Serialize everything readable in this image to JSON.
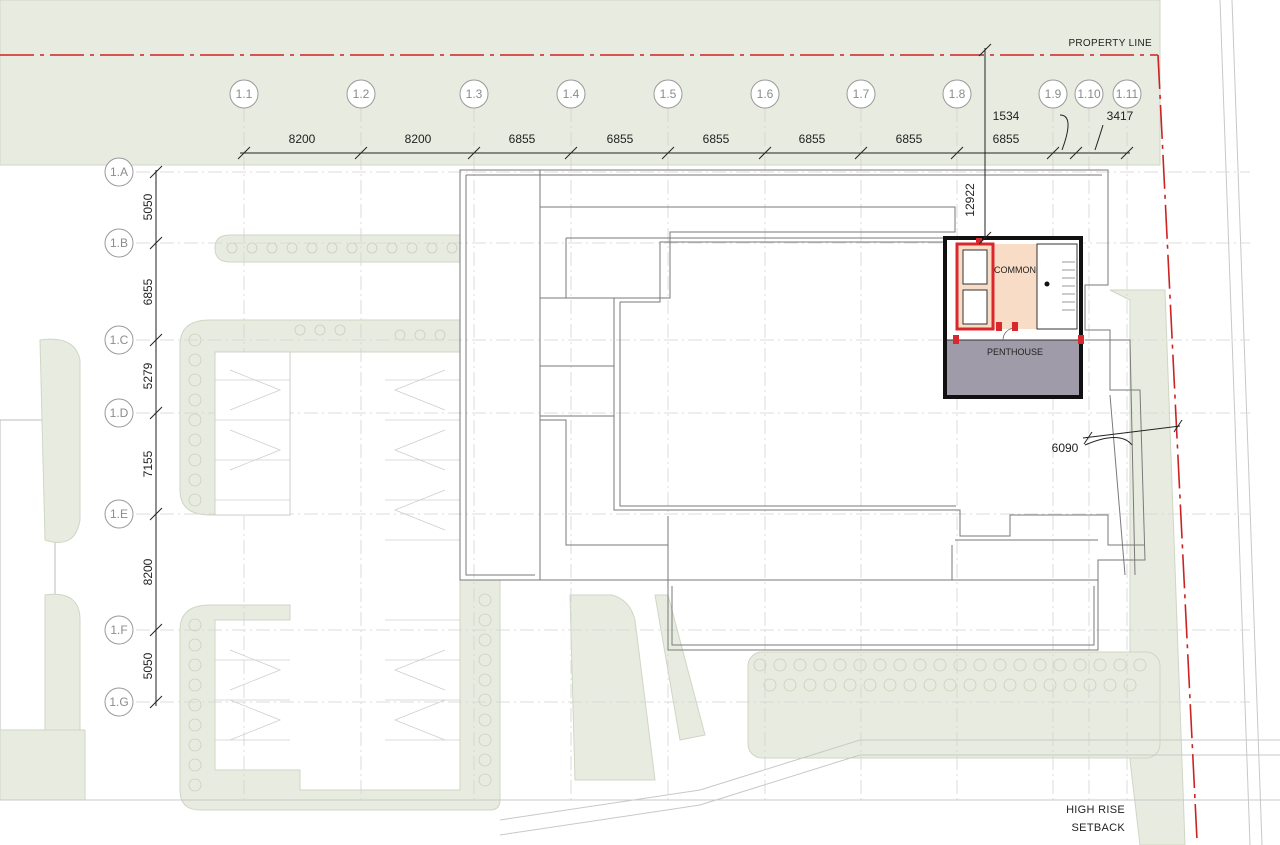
{
  "plan": {
    "grid_columns": [
      "1.1",
      "1.2",
      "1.3",
      "1.4",
      "1.5",
      "1.6",
      "1.7",
      "1.8",
      "1.9",
      "1.10",
      "1.11"
    ],
    "grid_rows": [
      "1.A",
      "1.B",
      "1.C",
      "1.D",
      "1.E",
      "1.F",
      "1.G"
    ],
    "column_dimensions": [
      "8200",
      "8200",
      "6855",
      "6855",
      "6855",
      "6855",
      "6855",
      "6855"
    ],
    "row_dimensions": [
      "5050",
      "6855",
      "5279",
      "7155",
      "8200",
      "5050"
    ],
    "extra_dimensions": {
      "d1534": "1534",
      "d3417": "3417",
      "d12922": "12922",
      "d6090": "6090"
    },
    "labels": {
      "property_line": "PROPERTY LINE",
      "high_rise_line1": "HIGH RISE",
      "high_rise_line2": "SETBACK",
      "common": "COMMON",
      "penthouse": "PENTHOUSE"
    },
    "colors": {
      "landscape": "#e8ece0",
      "property_line": "#cc2222",
      "common_room": "#f9dcc6",
      "penthouse_room": "#a09ba8",
      "core_red": "#d8282e",
      "grid_line": "#c8c8c8"
    }
  }
}
